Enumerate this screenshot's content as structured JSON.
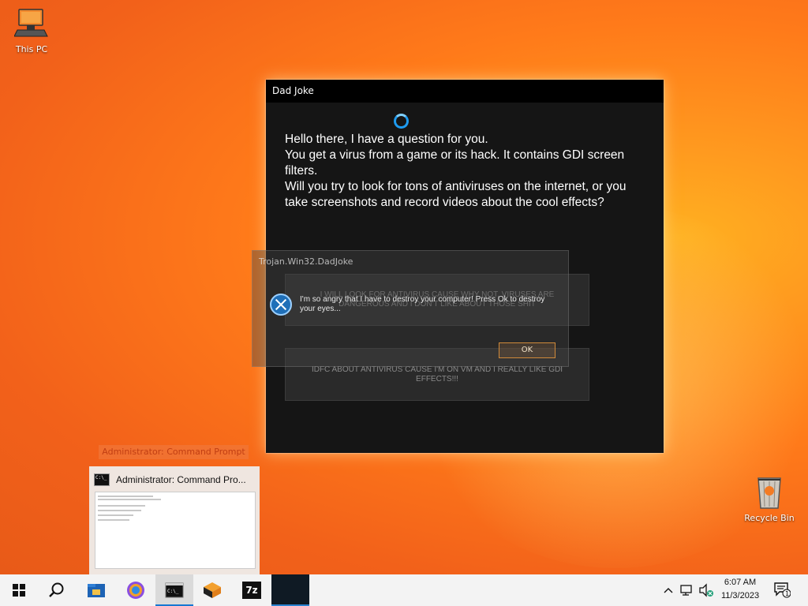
{
  "desktop": {
    "icons": [
      {
        "label": "This PC",
        "icon": "computer-icon"
      },
      {
        "label": "Recycle Bin",
        "icon": "recycle-bin-icon"
      }
    ]
  },
  "dad_joke_window": {
    "title": "Dad Joke",
    "question": "Hello there, I have a question for you.\nYou get a virus from a game or its hack. It contains GDI screen filters.\nWill you try to look for tons of antiviruses on the internet, or you take screenshots and record videos about the cool effects?",
    "option1": "I WILL LOOK FOR ANTIVIRUS CAUSE WHY NOT, VIRUSES ARE DANGEROUS AND I DON'T LIKE ABOUT THOSE SHIT",
    "option2": "IDFC ABOUT ANTIVIRUS CAUSE I'M ON VM AND I REALLY LIKE GDI EFFECTS!!!"
  },
  "error_box": {
    "title": "Trojan.Win32.DadJoke",
    "message": "I'm so angry that I have to destroy your computer! Press Ok to destroy your eyes...",
    "ok_label": "OK",
    "icon": "error-x-icon"
  },
  "taskbar_preview": {
    "tooltip": "Administrator: Command Prompt",
    "title": "Administrator: Command Pro...",
    "icon": "command-prompt-icon"
  },
  "taskbar": {
    "start_icon": "windows-logo-icon",
    "search_icon": "search-icon",
    "apps": [
      {
        "name": "file-explorer",
        "icon": "folder-icon"
      },
      {
        "name": "browser",
        "icon": "browser-icon"
      },
      {
        "name": "command-prompt",
        "icon": "command-prompt-icon",
        "active": true
      },
      {
        "name": "virtualbox",
        "icon": "box-icon"
      },
      {
        "name": "7zip",
        "icon": "7zip-icon",
        "label": "7z"
      },
      {
        "name": "dad-joke-app",
        "icon": "blank-window-icon"
      }
    ],
    "tray": {
      "time": "6:07 AM",
      "date": "11/3/2023",
      "notification_count": "1"
    }
  },
  "colors": {
    "accent": "#1677d2",
    "window_bg": "#151515",
    "desktop_orange": "#ff7a1a"
  }
}
